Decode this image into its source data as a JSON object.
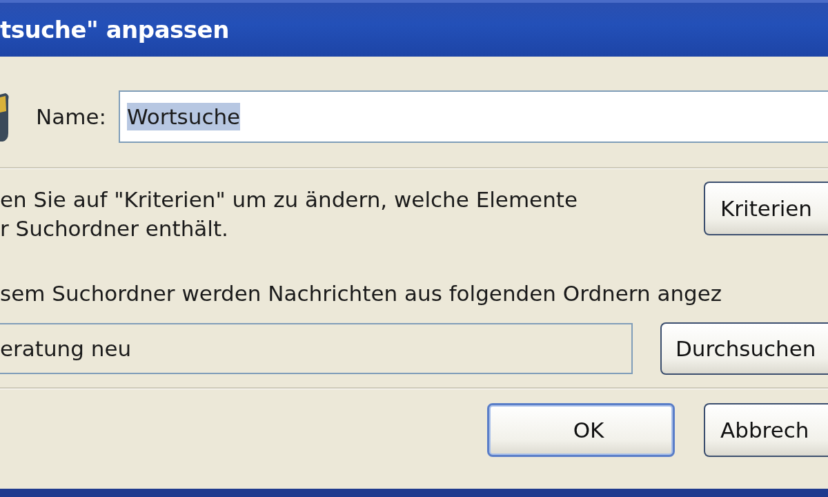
{
  "window": {
    "title": "tsuche\" anpassen"
  },
  "name_row": {
    "label": "Name:",
    "value": "Wortsuche",
    "value_selected": true
  },
  "criteria": {
    "lines": [
      "en Sie auf \"Kriterien\" um zu ändern, welche Elemente",
      "r Suchordner enthält."
    ],
    "button": {
      "label": "Kriterien",
      "default": false
    }
  },
  "folders": {
    "label": "sem Suchordner werden Nachrichten aus folgenden Ordnern angez",
    "value": "eratung neu",
    "button": {
      "label": "Durchsuchen",
      "default": false
    }
  },
  "buttons": [
    {
      "label": "OK",
      "default": true
    },
    {
      "label": "Abbrech",
      "default": false
    }
  ]
}
